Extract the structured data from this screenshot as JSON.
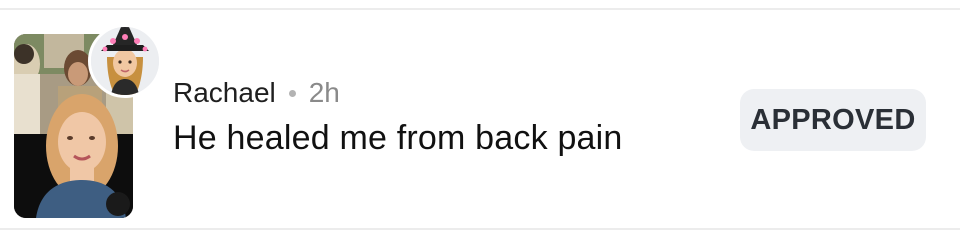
{
  "comment_item": {
    "username": "Rachael",
    "time_ago": "2h",
    "text": "He healed me from back pain",
    "status_badge": "APPROVED"
  },
  "colors": {
    "badge_bg": "#eef0f3",
    "badge_text": "#2a2f36",
    "meta_time": "#8a8a8a",
    "divider": "#ececec"
  },
  "icons": {
    "thumbnail": "video-thumbnail",
    "avatar": "bitmoji-avatar-witch-hat"
  }
}
